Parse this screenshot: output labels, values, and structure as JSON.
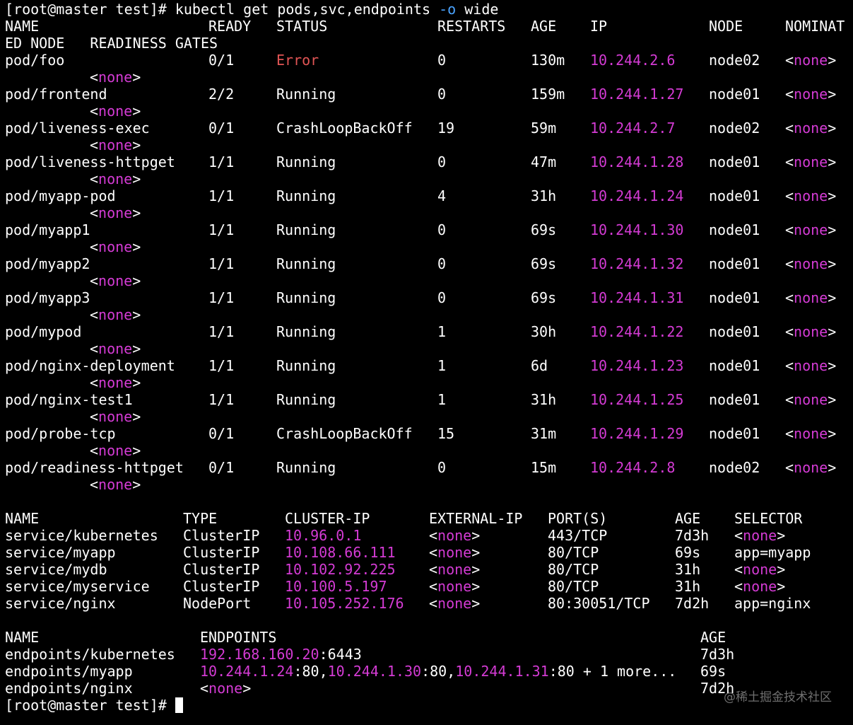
{
  "prompt": "[root@master test]#",
  "command": {
    "base": "kubectl get pods,svc,endpoints ",
    "flag": "-o",
    "rest": " wide"
  },
  "pods_header": {
    "name": "NAME",
    "ready": "READY",
    "status": "STATUS",
    "restarts": "RESTARTS",
    "age": "AGE",
    "ip": "IP",
    "node": "NODE",
    "nominat": "NOMINAT",
    "wrap": "ED NODE   READINESS GATES"
  },
  "none": "none",
  "pods": [
    {
      "name": "pod/foo",
      "ready": "0/1",
      "status": "Error",
      "status_error": true,
      "restarts": "0",
      "age": "130m",
      "ip": "10.244.2.6",
      "node": "node02"
    },
    {
      "name": "pod/frontend",
      "ready": "2/2",
      "status": "Running",
      "restarts": "0",
      "age": "159m",
      "ip": "10.244.1.27",
      "node": "node01"
    },
    {
      "name": "pod/liveness-exec",
      "ready": "0/1",
      "status": "CrashLoopBackOff",
      "restarts": "19",
      "age": "59m",
      "ip": "10.244.2.7",
      "node": "node02"
    },
    {
      "name": "pod/liveness-httpget",
      "ready": "1/1",
      "status": "Running",
      "restarts": "0",
      "age": "47m",
      "ip": "10.244.1.28",
      "node": "node01"
    },
    {
      "name": "pod/myapp-pod",
      "ready": "1/1",
      "status": "Running",
      "restarts": "4",
      "age": "31h",
      "ip": "10.244.1.24",
      "node": "node01"
    },
    {
      "name": "pod/myapp1",
      "ready": "1/1",
      "status": "Running",
      "restarts": "0",
      "age": "69s",
      "ip": "10.244.1.30",
      "node": "node01"
    },
    {
      "name": "pod/myapp2",
      "ready": "1/1",
      "status": "Running",
      "restarts": "0",
      "age": "69s",
      "ip": "10.244.1.32",
      "node": "node01"
    },
    {
      "name": "pod/myapp3",
      "ready": "1/1",
      "status": "Running",
      "restarts": "0",
      "age": "69s",
      "ip": "10.244.1.31",
      "node": "node01"
    },
    {
      "name": "pod/mypod",
      "ready": "1/1",
      "status": "Running",
      "restarts": "1",
      "age": "30h",
      "ip": "10.244.1.22",
      "node": "node01"
    },
    {
      "name": "pod/nginx-deployment",
      "ready": "1/1",
      "status": "Running",
      "restarts": "1",
      "age": "6d",
      "ip": "10.244.1.23",
      "node": "node01"
    },
    {
      "name": "pod/nginx-test1",
      "ready": "1/1",
      "status": "Running",
      "restarts": "1",
      "age": "31h",
      "ip": "10.244.1.25",
      "node": "node01"
    },
    {
      "name": "pod/probe-tcp",
      "ready": "0/1",
      "status": "CrashLoopBackOff",
      "restarts": "15",
      "age": "31m",
      "ip": "10.244.1.29",
      "node": "node01"
    },
    {
      "name": "pod/readiness-httpget",
      "ready": "0/1",
      "status": "Running",
      "restarts": "0",
      "age": "15m",
      "ip": "10.244.2.8",
      "node": "node02"
    }
  ],
  "svc_header": {
    "name": "NAME",
    "type": "TYPE",
    "cluster_ip": "CLUSTER-IP",
    "external_ip": "EXTERNAL-IP",
    "ports": "PORT(S)",
    "age": "AGE",
    "selector": "SELECTOR"
  },
  "services": [
    {
      "name": "service/kubernetes",
      "type": "ClusterIP",
      "cluster_ip": "10.96.0.1",
      "ports": "443/TCP",
      "age": "7d3h",
      "selector": "",
      "selector_none": true
    },
    {
      "name": "service/myapp",
      "type": "ClusterIP",
      "cluster_ip": "10.108.66.111",
      "ports": "80/TCP",
      "age": "69s",
      "selector": "app=myapp",
      "selector_none": false
    },
    {
      "name": "service/mydb",
      "type": "ClusterIP",
      "cluster_ip": "10.102.92.225",
      "ports": "80/TCP",
      "age": "31h",
      "selector": "",
      "selector_none": true
    },
    {
      "name": "service/myservice",
      "type": "ClusterIP",
      "cluster_ip": "10.100.5.197",
      "ports": "80/TCP",
      "age": "31h",
      "selector": "",
      "selector_none": true
    },
    {
      "name": "service/nginx",
      "type": "NodePort",
      "cluster_ip": "10.105.252.176",
      "ports": "80:30051/TCP",
      "age": "7d2h",
      "selector": "app=nginx",
      "selector_none": false
    }
  ],
  "ep_header": {
    "name": "NAME",
    "endpoints": "ENDPOINTS",
    "age": "AGE"
  },
  "endpoints": [
    {
      "name": "endpoints/kubernetes",
      "age": "7d3h",
      "parts": [
        {
          "ip": "192.168.160.20",
          "port": ":6443"
        }
      ],
      "more": ""
    },
    {
      "name": "endpoints/myapp",
      "age": "69s",
      "parts": [
        {
          "ip": "10.244.1.24",
          "port": ":80,"
        },
        {
          "ip": "10.244.1.30",
          "port": ":80,"
        },
        {
          "ip": "10.244.1.31",
          "port": ":80"
        }
      ],
      "more": " + 1 more..."
    },
    {
      "name": "endpoints/nginx",
      "age": "7d2h",
      "parts": [],
      "more": "",
      "none": true
    }
  ],
  "watermark": "@稀土掘金技术社区",
  "colors": {
    "ip": "#d43bd4",
    "error": "#e25555",
    "flag": "#4aa3ff",
    "background": "#000000",
    "text": "#ffffff"
  }
}
